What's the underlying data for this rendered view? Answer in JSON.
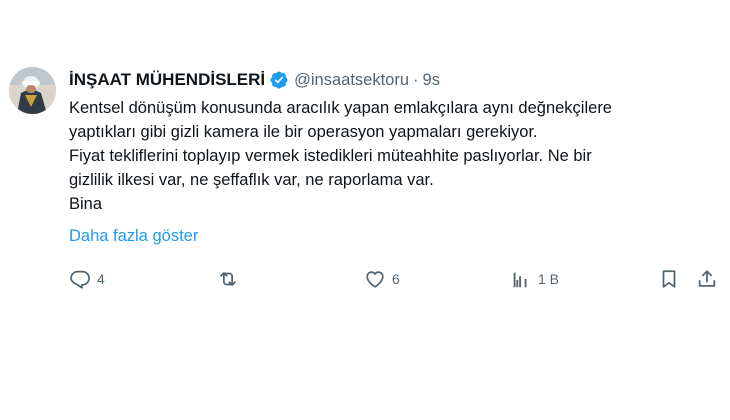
{
  "tweet": {
    "display_name": "İNŞAAT MÜHENDİSLERİ",
    "handle": "@insaatsektoru",
    "separator": "·",
    "time": "9s",
    "lines": [
      "Kentsel dönüşüm konusunda aracılık yapan emlakçılara aynı değnekçilere",
      "yaptıkları gibi gizli kamera ile bir operasyon yapmaları gerekiyor.",
      "Fiyat tekliflerini toplayıp vermek istedikleri müteahhite paslıyorlar. Ne bir",
      "gizlilik ilkesi var, ne şeffaflık var, ne raporlama var.",
      "Bina"
    ],
    "show_more": "Daha fazla göster"
  },
  "actions": {
    "replies": "4",
    "likes": "6",
    "views": "1 B"
  },
  "colors": {
    "accent": "#1d9bf0",
    "text": "#0f1419",
    "muted": "#536471"
  },
  "icons": {
    "verified": "verified-badge-icon",
    "reply": "reply-icon",
    "retweet": "retweet-icon",
    "like": "heart-icon",
    "views": "views-chart-icon",
    "bookmark": "bookmark-icon",
    "share": "share-icon"
  }
}
